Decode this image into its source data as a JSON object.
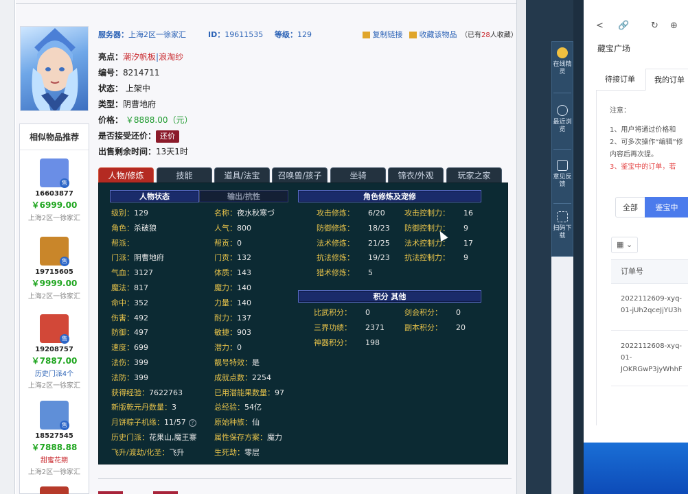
{
  "listing": {
    "server_label": "服务器：",
    "server_value": "上海2区一徐家汇",
    "id_label": "ID：",
    "id_value": "19611535",
    "level_label": "等级：",
    "level_value": "129",
    "copy_link": "复制链接",
    "favorite": "收藏该物品",
    "fav_prefix": "（已有",
    "fav_count": "28",
    "fav_suffix": "人收藏）",
    "highlight_label": "亮点：",
    "highlight_1": "潮汐帆板",
    "highlight_sep": "|",
    "highlight_2": "浪淘纱",
    "number_label": "编号：",
    "number_value": "8214711",
    "status_label": "状态：",
    "status_value": "上架中",
    "type_label": "类型：",
    "type_value": "阴曹地府",
    "price_label": "价格：",
    "price_value": "￥8888.00（元）",
    "bargain_label": "是否接受还价：",
    "bargain_button": "还价",
    "remaining_label": "出售剩余时间：",
    "remaining_value": "13天1时"
  },
  "similar": {
    "title": "相似物品推荐",
    "items": [
      {
        "id": "16603877",
        "price": "￥6999.00",
        "extra": "",
        "server": "上海2区一徐家汇",
        "icon_color": "#6a8ee6",
        "sell": "售"
      },
      {
        "id": "19715605",
        "price": "￥9999.00",
        "extra": "",
        "server": "上海2区一徐家汇",
        "icon_color": "#c9862a",
        "sell": "售"
      },
      {
        "id": "19208757",
        "price": "￥7887.00",
        "extra": "历史门派4个",
        "server": "上海2区一徐家汇",
        "icon_color": "#d24838",
        "sell": "售"
      },
      {
        "id": "18527545",
        "price": "￥7888.88",
        "extra": "甜蜜花期",
        "server": "上海2区一徐家汇",
        "icon_color": "#5f8fd8",
        "sell": "售"
      }
    ]
  },
  "tabs": [
    "人物/修炼",
    "技能",
    "道具/法宝",
    "召唤兽/孩子",
    "坐骑",
    "锦衣/外观",
    "玩家之家"
  ],
  "panel": {
    "header_status": "人物状态",
    "header_resist": "输出/抗性",
    "header_cultivation": "角色修炼及宠修",
    "header_points": "积分 其他",
    "left_col": [
      {
        "k": "级别：",
        "v": "129"
      },
      {
        "k": "角色：",
        "v": "杀破狼"
      },
      {
        "k": "帮派：",
        "v": ""
      },
      {
        "k": "门派：",
        "v": "阴曹地府"
      },
      {
        "k": "气血：",
        "v": "3127"
      },
      {
        "k": "魔法：",
        "v": "817"
      },
      {
        "k": "命中：",
        "v": "352"
      },
      {
        "k": "伤害：",
        "v": "492"
      },
      {
        "k": "防御：",
        "v": "497"
      },
      {
        "k": "速度：",
        "v": "699"
      },
      {
        "k": "法伤：",
        "v": "399"
      },
      {
        "k": "法防：",
        "v": "399"
      },
      {
        "k": "获得经验：",
        "v": "7622763"
      },
      {
        "k": "新版乾元丹数量：",
        "v": "3"
      },
      {
        "k": "月饼粽子机缘：",
        "v": "11/57"
      },
      {
        "k": "历史门派：",
        "v": "花果山,魔王寨"
      },
      {
        "k": "飞升/渡劫/化圣：",
        "v": "飞升"
      }
    ],
    "mid_col": [
      {
        "k": "名称：",
        "v": "夜水秋寒づ"
      },
      {
        "k": "人气：",
        "v": "800"
      },
      {
        "k": "帮贡：",
        "v": "0"
      },
      {
        "k": "门贡：",
        "v": "132"
      },
      {
        "k": "体质：",
        "v": "143"
      },
      {
        "k": "魔力：",
        "v": "140"
      },
      {
        "k": "力量：",
        "v": "140"
      },
      {
        "k": "耐力：",
        "v": "137"
      },
      {
        "k": "敏捷：",
        "v": "903"
      },
      {
        "k": "潜力：",
        "v": "0"
      },
      {
        "k": "靓号特效：",
        "v": "是"
      },
      {
        "k": "成就点数：",
        "v": "2254"
      },
      {
        "k": "已用潜能果数量：",
        "v": "97"
      },
      {
        "k": "总经验：",
        "v": "54亿"
      },
      {
        "k": "原始种族：",
        "v": "仙"
      },
      {
        "k": "属性保存方案：",
        "v": "魔力"
      },
      {
        "k": "生死劫：",
        "v": "零层"
      }
    ],
    "cultivation_left": [
      {
        "k": "攻击修炼：",
        "v": "6/20"
      },
      {
        "k": "防御修炼：",
        "v": "18/23"
      },
      {
        "k": "法术修炼：",
        "v": "21/25"
      },
      {
        "k": "抗法修炼：",
        "v": "19/23"
      },
      {
        "k": "猎术修炼：",
        "v": "5"
      }
    ],
    "cultivation_right": [
      {
        "k": "攻击控制力：",
        "v": "16"
      },
      {
        "k": "防御控制力：",
        "v": "9"
      },
      {
        "k": "法术控制力：",
        "v": "17"
      },
      {
        "k": "抗法控制力：",
        "v": "9"
      }
    ],
    "points_left": [
      {
        "k": "比武积分：",
        "v": "0"
      },
      {
        "k": "三界功绩：",
        "v": "2371"
      },
      {
        "k": "神器积分：",
        "v": "198"
      }
    ],
    "points_right": [
      {
        "k": "剑会积分：",
        "v": "0"
      },
      {
        "k": "副本积分：",
        "v": "20"
      }
    ]
  },
  "toolbar": [
    {
      "label": "在线精灵",
      "icon": "elf-icon"
    },
    {
      "label": "最近浏览",
      "icon": "clock-icon"
    },
    {
      "label": "意见反馈",
      "icon": "edit-icon"
    },
    {
      "label": "扫码下载",
      "icon": "scan-icon"
    }
  ],
  "right_panel": {
    "browser_icons": [
      "<",
      "🔗",
      "↻",
      "⊕"
    ],
    "title": "藏宝广场",
    "tab_pending": "待接订单",
    "tab_mine": "我的订单",
    "notice_title": "注意：",
    "notice_1": "1、用户将通过价格和",
    "notice_2": "2、可多次操作“编辑”修",
    "notice_2b": "内容后再次提。",
    "notice_3": "3、鉴宝中的订单，若",
    "filter_all": "全部",
    "filter_active": "鉴宝中",
    "grid_label": "▦ ⌄",
    "col_order": "订单号",
    "orders": [
      {
        "line1": "2022112609-xyq-",
        "line2": "01-jUh2qceJjYU3h"
      },
      {
        "line1": "2022112608-xyq-",
        "line2": "01-",
        "line3": "JOKRGwP3jyWhhF"
      }
    ]
  }
}
